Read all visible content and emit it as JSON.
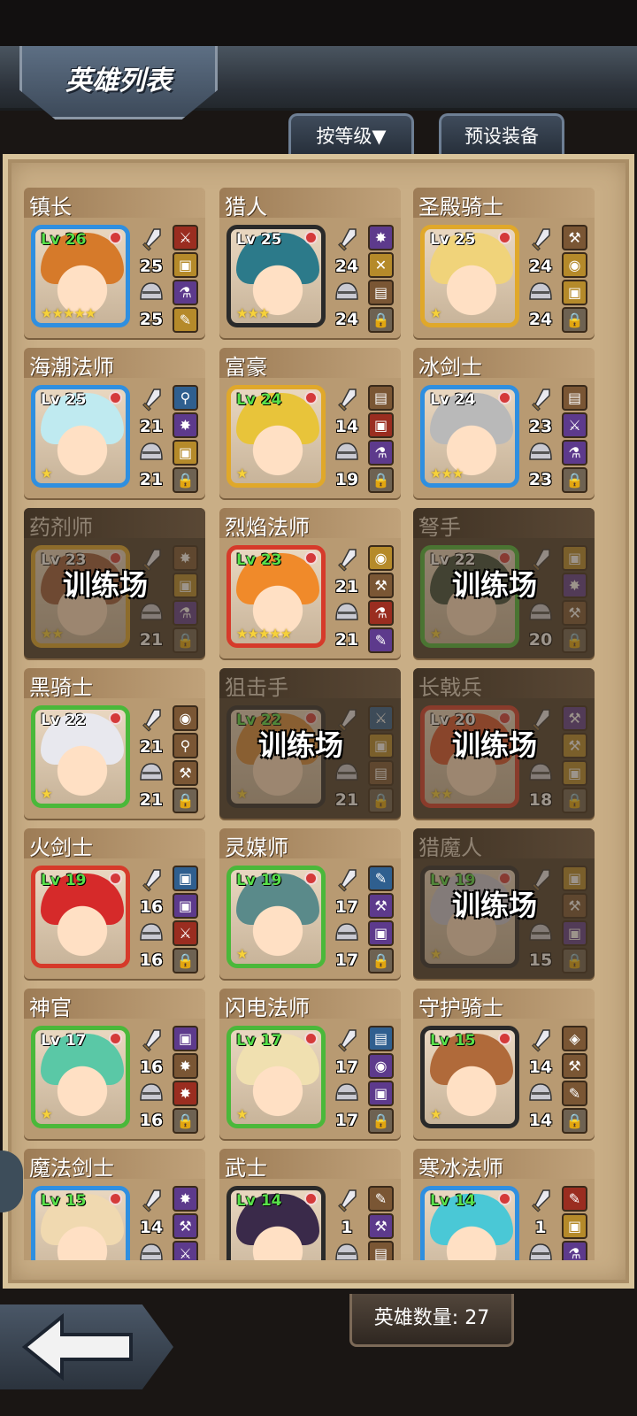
{
  "header": {
    "title": "英雄列表",
    "sort_button": "按等级▼",
    "preset_button": "预设装备"
  },
  "footer": {
    "hero_count": "英雄数量: 27"
  },
  "heroes": [
    {
      "name": "镇长",
      "level": "Lv 26",
      "atk": "25",
      "def": "25",
      "stars": "★★★★★",
      "frame": "blue",
      "hair": "#d67a2a",
      "green_lv": true,
      "training": false,
      "equip": [
        [
          "c-red",
          "⚔"
        ],
        [
          "c-gold",
          "▣"
        ],
        [
          "c-purple",
          "⚗"
        ],
        [
          "c-gold",
          "✎"
        ]
      ]
    },
    {
      "name": "猎人",
      "level": "Lv 25",
      "atk": "24",
      "def": "24",
      "stars": "★★★",
      "frame": "black",
      "hair": "#2c7a8a",
      "green_lv": false,
      "training": false,
      "equip": [
        [
          "c-purple",
          "✸"
        ],
        [
          "c-gold",
          "✕"
        ],
        [
          "c-brown",
          "▤"
        ],
        [
          "c-lock",
          "🔒"
        ]
      ]
    },
    {
      "name": "圣殿骑士",
      "level": "Lv 25",
      "atk": "24",
      "def": "24",
      "stars": "★",
      "frame": "gold",
      "hair": "#f0d37a",
      "green_lv": false,
      "training": false,
      "equip": [
        [
          "c-brown",
          "⚒"
        ],
        [
          "c-gold",
          "◉"
        ],
        [
          "c-gold",
          "▣"
        ],
        [
          "c-lock",
          "🔒"
        ]
      ]
    },
    {
      "name": "海潮法师",
      "level": "Lv 25",
      "atk": "21",
      "def": "21",
      "stars": "★",
      "frame": "blue",
      "hair": "#bfeaf0",
      "green_lv": false,
      "training": false,
      "equip": [
        [
          "c-blue",
          "⚲"
        ],
        [
          "c-purple",
          "✸"
        ],
        [
          "c-gold",
          "▣"
        ],
        [
          "c-lock",
          "🔒"
        ]
      ]
    },
    {
      "name": "富豪",
      "level": "Lv 24",
      "atk": "14",
      "def": "19",
      "stars": "★",
      "frame": "gold",
      "hair": "#e8c43a",
      "green_lv": true,
      "training": false,
      "equip": [
        [
          "c-brown",
          "▤"
        ],
        [
          "c-red",
          "▣"
        ],
        [
          "c-purple",
          "⚗"
        ],
        [
          "c-lock",
          "🔒"
        ]
      ]
    },
    {
      "name": "冰剑士",
      "level": "Lv 24",
      "atk": "23",
      "def": "23",
      "stars": "★★★",
      "frame": "blue",
      "hair": "#b9b9b9",
      "green_lv": false,
      "training": false,
      "equip": [
        [
          "c-brown",
          "▤"
        ],
        [
          "c-purple",
          "⚔"
        ],
        [
          "c-purple",
          "⚗"
        ],
        [
          "c-lock",
          "🔒"
        ]
      ]
    },
    {
      "name": "药剂师",
      "level": "Lv 23",
      "atk": "",
      "def": "21",
      "stars": "★★",
      "frame": "gold",
      "hair": "#9a5a3a",
      "green_lv": false,
      "training": true,
      "equip": [
        [
          "c-brown",
          "✸"
        ],
        [
          "c-gold",
          "▣"
        ],
        [
          "c-purple",
          "⚗"
        ],
        [
          "c-lock",
          "🔒"
        ]
      ]
    },
    {
      "name": "烈焰法师",
      "level": "Lv 23",
      "atk": "21",
      "def": "21",
      "stars": "★★★★★",
      "frame": "red",
      "hair": "#f08a2a",
      "green_lv": true,
      "training": false,
      "equip": [
        [
          "c-gold",
          "◉"
        ],
        [
          "c-brown",
          "⚒"
        ],
        [
          "c-red",
          "⚗"
        ],
        [
          "c-purple",
          "✎"
        ]
      ]
    },
    {
      "name": "弩手",
      "level": "Lv 22",
      "atk": "",
      "def": "20",
      "stars": "★",
      "frame": "green",
      "hair": "#3a4a3a",
      "green_lv": false,
      "training": true,
      "equip": [
        [
          "c-gold",
          "▣"
        ],
        [
          "c-purple",
          "✸"
        ],
        [
          "c-brown",
          "⚒"
        ],
        [
          "c-lock",
          "🔒"
        ]
      ]
    },
    {
      "name": "黑骑士",
      "level": "Lv 22",
      "atk": "21",
      "def": "21",
      "stars": "★",
      "frame": "green",
      "hair": "#e8e8ee",
      "green_lv": false,
      "training": false,
      "equip": [
        [
          "c-brown",
          "◉"
        ],
        [
          "c-brown",
          "⚲"
        ],
        [
          "c-brown",
          "⚒"
        ],
        [
          "c-lock",
          "🔒"
        ]
      ]
    },
    {
      "name": "狙击手",
      "level": "Lv 22",
      "atk": "",
      "def": "21",
      "stars": "★",
      "frame": "black",
      "hair": "#d68a3a",
      "green_lv": true,
      "training": true,
      "equip": [
        [
          "c-blue",
          "⚔"
        ],
        [
          "c-gold",
          "▣"
        ],
        [
          "c-brown",
          "▤"
        ],
        [
          "c-lock",
          "🔒"
        ]
      ]
    },
    {
      "name": "长戟兵",
      "level": "Lv 20",
      "atk": "",
      "def": "18",
      "stars": "★★",
      "frame": "red",
      "hair": "#d6502a",
      "green_lv": false,
      "training": true,
      "equip": [
        [
          "c-purple",
          "⚒"
        ],
        [
          "c-gold",
          "⚒"
        ],
        [
          "c-gold",
          "▣"
        ],
        [
          "c-lock",
          "🔒"
        ]
      ]
    },
    {
      "name": "火剑士",
      "level": "Lv 19",
      "atk": "16",
      "def": "16",
      "stars": "",
      "frame": "red",
      "hair": "#d62a2a",
      "green_lv": true,
      "training": false,
      "equip": [
        [
          "c-blue",
          "▣"
        ],
        [
          "c-purple",
          "▣"
        ],
        [
          "c-red",
          "⚔"
        ],
        [
          "c-lock",
          "🔒"
        ]
      ]
    },
    {
      "name": "灵媒师",
      "level": "Lv 19",
      "atk": "17",
      "def": "17",
      "stars": "★",
      "frame": "green",
      "hair": "#5a8a8a",
      "green_lv": true,
      "training": false,
      "equip": [
        [
          "c-blue",
          "✎"
        ],
        [
          "c-purple",
          "⚒"
        ],
        [
          "c-purple",
          "▣"
        ],
        [
          "c-lock",
          "🔒"
        ]
      ]
    },
    {
      "name": "猎魔人",
      "level": "Lv 19",
      "atk": "",
      "def": "15",
      "stars": "★",
      "frame": "black",
      "hair": "#c9c9d6",
      "green_lv": true,
      "training": true,
      "equip": [
        [
          "c-gold",
          "▣"
        ],
        [
          "c-brown",
          "⚒"
        ],
        [
          "c-purple",
          "▣"
        ],
        [
          "c-lock",
          "🔒"
        ]
      ]
    },
    {
      "name": "神官",
      "level": "Lv 17",
      "atk": "16",
      "def": "16",
      "stars": "★",
      "frame": "green",
      "hair": "#5ac8a6",
      "green_lv": false,
      "training": false,
      "equip": [
        [
          "c-purple",
          "▣"
        ],
        [
          "c-brown",
          "✸"
        ],
        [
          "c-red",
          "✸"
        ],
        [
          "c-lock",
          "🔒"
        ]
      ]
    },
    {
      "name": "闪电法师",
      "level": "Lv 17",
      "atk": "17",
      "def": "17",
      "stars": "★",
      "frame": "green",
      "hair": "#f0e0b0",
      "green_lv": true,
      "training": false,
      "equip": [
        [
          "c-blue",
          "▤"
        ],
        [
          "c-purple",
          "◉"
        ],
        [
          "c-purple",
          "▣"
        ],
        [
          "c-lock",
          "🔒"
        ]
      ]
    },
    {
      "name": "守护骑士",
      "level": "Lv 15",
      "atk": "14",
      "def": "14",
      "stars": "★",
      "frame": "black",
      "hair": "#b06a3a",
      "green_lv": true,
      "training": false,
      "equip": [
        [
          "c-brown",
          "◈"
        ],
        [
          "c-brown",
          "⚒"
        ],
        [
          "c-brown",
          "✎"
        ],
        [
          "c-lock",
          "🔒"
        ]
      ]
    },
    {
      "name": "魔法剑士",
      "level": "Lv 15",
      "atk": "14",
      "def": "",
      "stars": "",
      "frame": "blue",
      "hair": "#f0d9b0",
      "green_lv": true,
      "training": false,
      "equip": [
        [
          "c-purple",
          "✸"
        ],
        [
          "c-purple",
          "⚒"
        ],
        [
          "c-purple",
          "⚔"
        ],
        [
          "c-lock",
          "🔒"
        ]
      ]
    },
    {
      "name": "武士",
      "level": "Lv 14",
      "atk": "1",
      "def": "",
      "stars": "",
      "frame": "black",
      "hair": "#3a2a4a",
      "green_lv": true,
      "training": false,
      "equip": [
        [
          "c-brown",
          "✎"
        ],
        [
          "c-purple",
          "⚒"
        ],
        [
          "c-brown",
          "▤"
        ],
        [
          "c-lock",
          "🔒"
        ]
      ]
    },
    {
      "name": "寒冰法师",
      "level": "Lv 14",
      "atk": "1",
      "def": "",
      "stars": "",
      "frame": "blue",
      "hair": "#4ac8d6",
      "green_lv": true,
      "training": false,
      "equip": [
        [
          "c-red",
          "✎"
        ],
        [
          "c-gold",
          "▣"
        ],
        [
          "c-purple",
          "⚗"
        ],
        [
          "c-lock",
          "🔒"
        ]
      ]
    }
  ],
  "training_label": "训练场",
  "colors": {
    "frame_blue": "#2f8fe0",
    "frame_gold": "#e0a82a",
    "frame_red": "#d63a2a",
    "frame_green": "#4ab83a",
    "frame_black": "#2a2a2a"
  }
}
